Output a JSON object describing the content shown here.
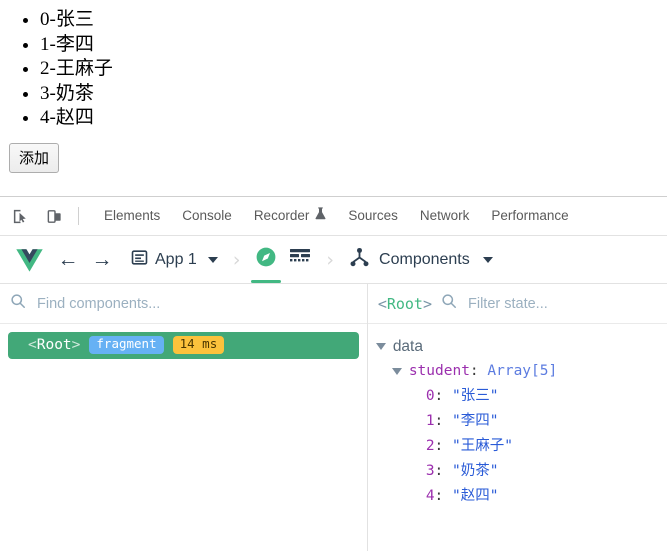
{
  "page": {
    "list_items": [
      "0-张三",
      "1-李四",
      "2-王麻子",
      "3-奶茶",
      "4-赵四"
    ],
    "add_button_label": "添加"
  },
  "devtools": {
    "icons": {
      "inspect": "inspect-element-icon",
      "device": "device-toolbar-icon"
    },
    "tabs": [
      {
        "label": "Elements",
        "icon": ""
      },
      {
        "label": "Console",
        "icon": ""
      },
      {
        "label": "Recorder",
        "icon": "flask-icon"
      },
      {
        "label": "Sources",
        "icon": ""
      },
      {
        "label": "Network",
        "icon": ""
      },
      {
        "label": "Performance",
        "icon": ""
      }
    ]
  },
  "vue_toolbar": {
    "logo": "vue-logo-icon",
    "back_icon": "arrow-left-icon",
    "forward_icon": "arrow-right-icon",
    "app_icon": "app-document-icon",
    "app_label": "App 1",
    "chevron": "›",
    "inspector_icon": "compass-pin-icon",
    "timeline_icon": "timeline-grid-icon",
    "components_icon": "component-tree-icon",
    "components_label": "Components"
  },
  "components_pane": {
    "search_placeholder": "Find components...",
    "search_value": "",
    "search_icon": "search-icon",
    "tree": [
      {
        "open_bracket": "<",
        "name": "Root",
        "close_bracket": ">",
        "badges": [
          {
            "text": "fragment",
            "kind": "fragment"
          },
          {
            "text": "14 ms",
            "kind": "time"
          }
        ]
      }
    ]
  },
  "state_pane": {
    "selected_open": "<",
    "selected_name": "Root",
    "selected_close": ">",
    "filter_placeholder": "Filter state...",
    "filter_value": "",
    "search_icon": "search-icon",
    "group_label": "data",
    "array_key": "student",
    "array_type": "Array[5]",
    "items": [
      {
        "index": "0",
        "value": "\"张三\""
      },
      {
        "index": "1",
        "value": "\"李四\""
      },
      {
        "index": "2",
        "value": "\"王麻子\""
      },
      {
        "index": "3",
        "value": "\"奶茶\""
      },
      {
        "index": "4",
        "value": "\"赵四\""
      }
    ]
  },
  "colors": {
    "vue_green": "#42b883",
    "node_selected_bg": "#42a878",
    "badge_fragment": "#66b1f4",
    "badge_time": "#fcc23c",
    "key_purple": "#9b2fae",
    "string_blue": "#2a5bd7",
    "type_blue": "#5c7ce0"
  }
}
